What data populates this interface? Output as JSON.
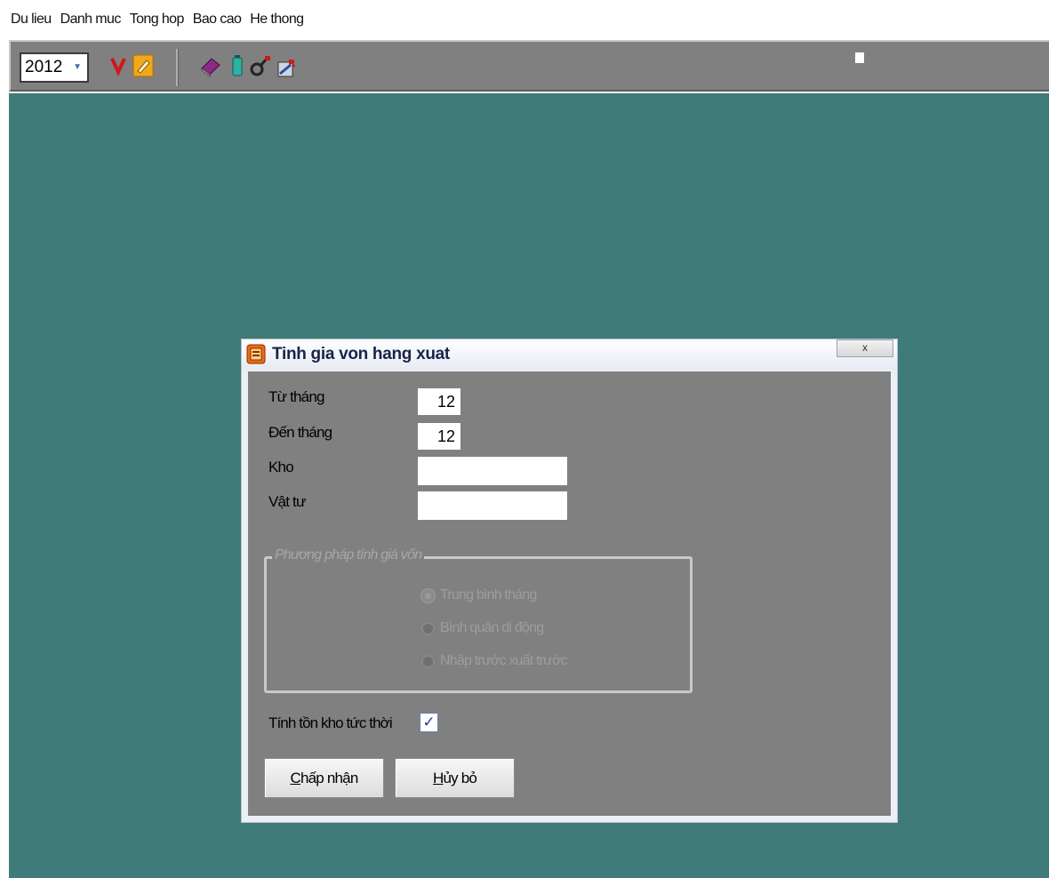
{
  "menu": [
    "Du lieu",
    "Danh muc",
    "Tong hop",
    "Bao cao",
    "He thong"
  ],
  "toolbar": {
    "year": "2012",
    "icons": [
      "v-icon",
      "edit-icon",
      "book-icon",
      "battery-icon",
      "tool-icon",
      "report-icon"
    ]
  },
  "dialog": {
    "title": "Tinh gia von hang xuat",
    "close_label": "x",
    "fields": {
      "from_month_label": "Từ tháng",
      "from_month_value": "12",
      "to_month_label": "Đến tháng",
      "to_month_value": "12",
      "warehouse_label": "Kho",
      "warehouse_value": "",
      "material_label": "Vật tư",
      "material_value": ""
    },
    "method_group": {
      "title": "Phương pháp tính giá vốn",
      "options": [
        "Trung bình tháng",
        "Bình quân di động",
        "Nhập trước xuất trước"
      ],
      "selected_index": 0
    },
    "instant_stock_label": "Tính tồn kho tức thời",
    "instant_stock_checked": true,
    "accept_first": "C",
    "accept_rest": "hấp nhận",
    "cancel_first": "H",
    "cancel_rest": "ủy bỏ"
  },
  "colors": {
    "desktop": "#3f7b79",
    "toolbar": "#808080",
    "dialog_body": "#808080"
  }
}
